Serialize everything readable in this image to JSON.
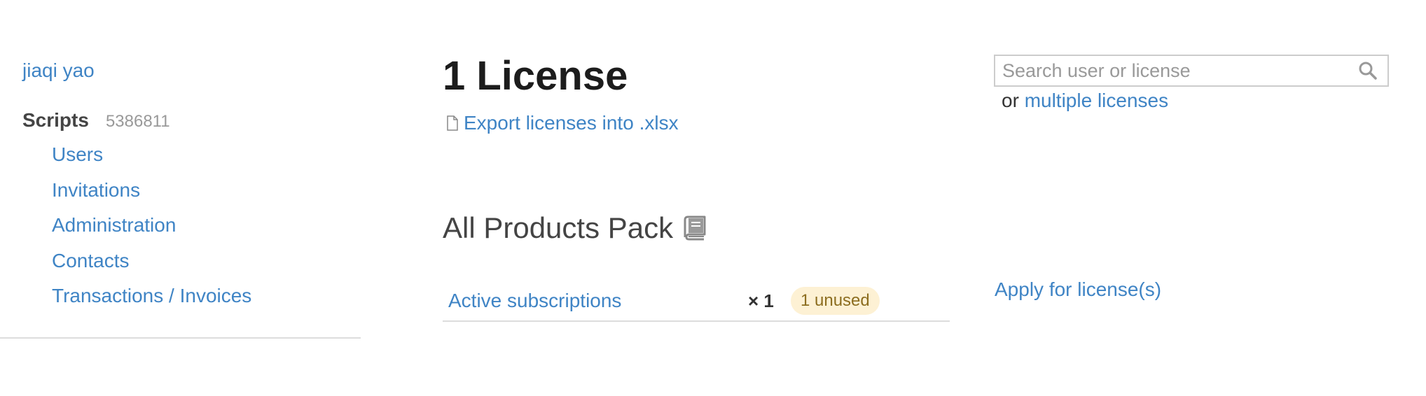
{
  "sidebar": {
    "user_name": "jiaqi yao",
    "org_name": "Scripts",
    "org_id": "5386811",
    "items": [
      {
        "label": "Users"
      },
      {
        "label": "Invitations"
      },
      {
        "label": "Administration"
      },
      {
        "label": "Contacts"
      },
      {
        "label": "Transactions / Invoices"
      }
    ]
  },
  "main": {
    "title": "1 License",
    "export_label": "Export licenses into .xlsx",
    "export_icon": "file-icon",
    "product": {
      "name": "All Products Pack",
      "icon": "book-icon",
      "subscriptions_label": "Active subscriptions",
      "count": "× 1",
      "unused_badge": "1 unused"
    }
  },
  "search": {
    "placeholder": "Search user or license",
    "value": "",
    "icon": "search-icon",
    "multi_prefix": "or",
    "multi_link": "multiple licenses"
  },
  "actions": {
    "apply_label": "Apply for license(s)"
  },
  "colors": {
    "link": "#3f84c5",
    "badge_bg": "#fdf1d4",
    "badge_text": "#8c6d1f",
    "divider": "#dddddd"
  }
}
